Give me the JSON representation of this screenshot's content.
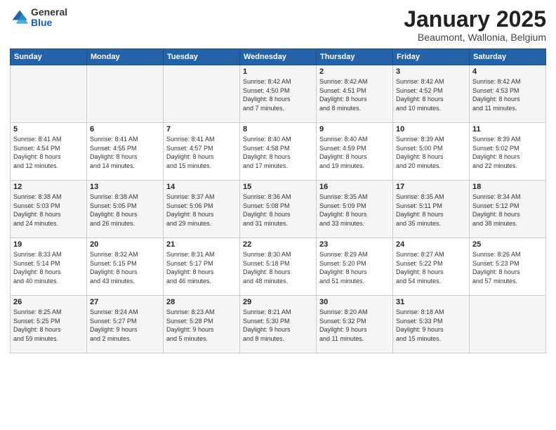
{
  "header": {
    "logo_general": "General",
    "logo_blue": "Blue",
    "title": "January 2025",
    "subtitle": "Beaumont, Wallonia, Belgium"
  },
  "weekdays": [
    "Sunday",
    "Monday",
    "Tuesday",
    "Wednesday",
    "Thursday",
    "Friday",
    "Saturday"
  ],
  "weeks": [
    [
      {
        "day": "",
        "info": ""
      },
      {
        "day": "",
        "info": ""
      },
      {
        "day": "",
        "info": ""
      },
      {
        "day": "1",
        "info": "Sunrise: 8:42 AM\nSunset: 4:50 PM\nDaylight: 8 hours\nand 7 minutes."
      },
      {
        "day": "2",
        "info": "Sunrise: 8:42 AM\nSunset: 4:51 PM\nDaylight: 8 hours\nand 8 minutes."
      },
      {
        "day": "3",
        "info": "Sunrise: 8:42 AM\nSunset: 4:52 PM\nDaylight: 8 hours\nand 10 minutes."
      },
      {
        "day": "4",
        "info": "Sunrise: 8:42 AM\nSunset: 4:53 PM\nDaylight: 8 hours\nand 11 minutes."
      }
    ],
    [
      {
        "day": "5",
        "info": "Sunrise: 8:41 AM\nSunset: 4:54 PM\nDaylight: 8 hours\nand 12 minutes."
      },
      {
        "day": "6",
        "info": "Sunrise: 8:41 AM\nSunset: 4:55 PM\nDaylight: 8 hours\nand 14 minutes."
      },
      {
        "day": "7",
        "info": "Sunrise: 8:41 AM\nSunset: 4:57 PM\nDaylight: 8 hours\nand 15 minutes."
      },
      {
        "day": "8",
        "info": "Sunrise: 8:40 AM\nSunset: 4:58 PM\nDaylight: 8 hours\nand 17 minutes."
      },
      {
        "day": "9",
        "info": "Sunrise: 8:40 AM\nSunset: 4:59 PM\nDaylight: 8 hours\nand 19 minutes."
      },
      {
        "day": "10",
        "info": "Sunrise: 8:39 AM\nSunset: 5:00 PM\nDaylight: 8 hours\nand 20 minutes."
      },
      {
        "day": "11",
        "info": "Sunrise: 8:39 AM\nSunset: 5:02 PM\nDaylight: 8 hours\nand 22 minutes."
      }
    ],
    [
      {
        "day": "12",
        "info": "Sunrise: 8:38 AM\nSunset: 5:03 PM\nDaylight: 8 hours\nand 24 minutes."
      },
      {
        "day": "13",
        "info": "Sunrise: 8:38 AM\nSunset: 5:05 PM\nDaylight: 8 hours\nand 26 minutes."
      },
      {
        "day": "14",
        "info": "Sunrise: 8:37 AM\nSunset: 5:06 PM\nDaylight: 8 hours\nand 29 minutes."
      },
      {
        "day": "15",
        "info": "Sunrise: 8:36 AM\nSunset: 5:08 PM\nDaylight: 8 hours\nand 31 minutes."
      },
      {
        "day": "16",
        "info": "Sunrise: 8:35 AM\nSunset: 5:09 PM\nDaylight: 8 hours\nand 33 minutes."
      },
      {
        "day": "17",
        "info": "Sunrise: 8:35 AM\nSunset: 5:11 PM\nDaylight: 8 hours\nand 35 minutes."
      },
      {
        "day": "18",
        "info": "Sunrise: 8:34 AM\nSunset: 5:12 PM\nDaylight: 8 hours\nand 38 minutes."
      }
    ],
    [
      {
        "day": "19",
        "info": "Sunrise: 8:33 AM\nSunset: 5:14 PM\nDaylight: 8 hours\nand 40 minutes."
      },
      {
        "day": "20",
        "info": "Sunrise: 8:32 AM\nSunset: 5:15 PM\nDaylight: 8 hours\nand 43 minutes."
      },
      {
        "day": "21",
        "info": "Sunrise: 8:31 AM\nSunset: 5:17 PM\nDaylight: 8 hours\nand 46 minutes."
      },
      {
        "day": "22",
        "info": "Sunrise: 8:30 AM\nSunset: 5:18 PM\nDaylight: 8 hours\nand 48 minutes."
      },
      {
        "day": "23",
        "info": "Sunrise: 8:29 AM\nSunset: 5:20 PM\nDaylight: 8 hours\nand 51 minutes."
      },
      {
        "day": "24",
        "info": "Sunrise: 8:27 AM\nSunset: 5:22 PM\nDaylight: 8 hours\nand 54 minutes."
      },
      {
        "day": "25",
        "info": "Sunrise: 8:26 AM\nSunset: 5:23 PM\nDaylight: 8 hours\nand 57 minutes."
      }
    ],
    [
      {
        "day": "26",
        "info": "Sunrise: 8:25 AM\nSunset: 5:25 PM\nDaylight: 8 hours\nand 59 minutes."
      },
      {
        "day": "27",
        "info": "Sunrise: 8:24 AM\nSunset: 5:27 PM\nDaylight: 9 hours\nand 2 minutes."
      },
      {
        "day": "28",
        "info": "Sunrise: 8:23 AM\nSunset: 5:28 PM\nDaylight: 9 hours\nand 5 minutes."
      },
      {
        "day": "29",
        "info": "Sunrise: 8:21 AM\nSunset: 5:30 PM\nDaylight: 9 hours\nand 8 minutes."
      },
      {
        "day": "30",
        "info": "Sunrise: 8:20 AM\nSunset: 5:32 PM\nDaylight: 9 hours\nand 11 minutes."
      },
      {
        "day": "31",
        "info": "Sunrise: 8:18 AM\nSunset: 5:33 PM\nDaylight: 9 hours\nand 15 minutes."
      },
      {
        "day": "",
        "info": ""
      }
    ]
  ]
}
